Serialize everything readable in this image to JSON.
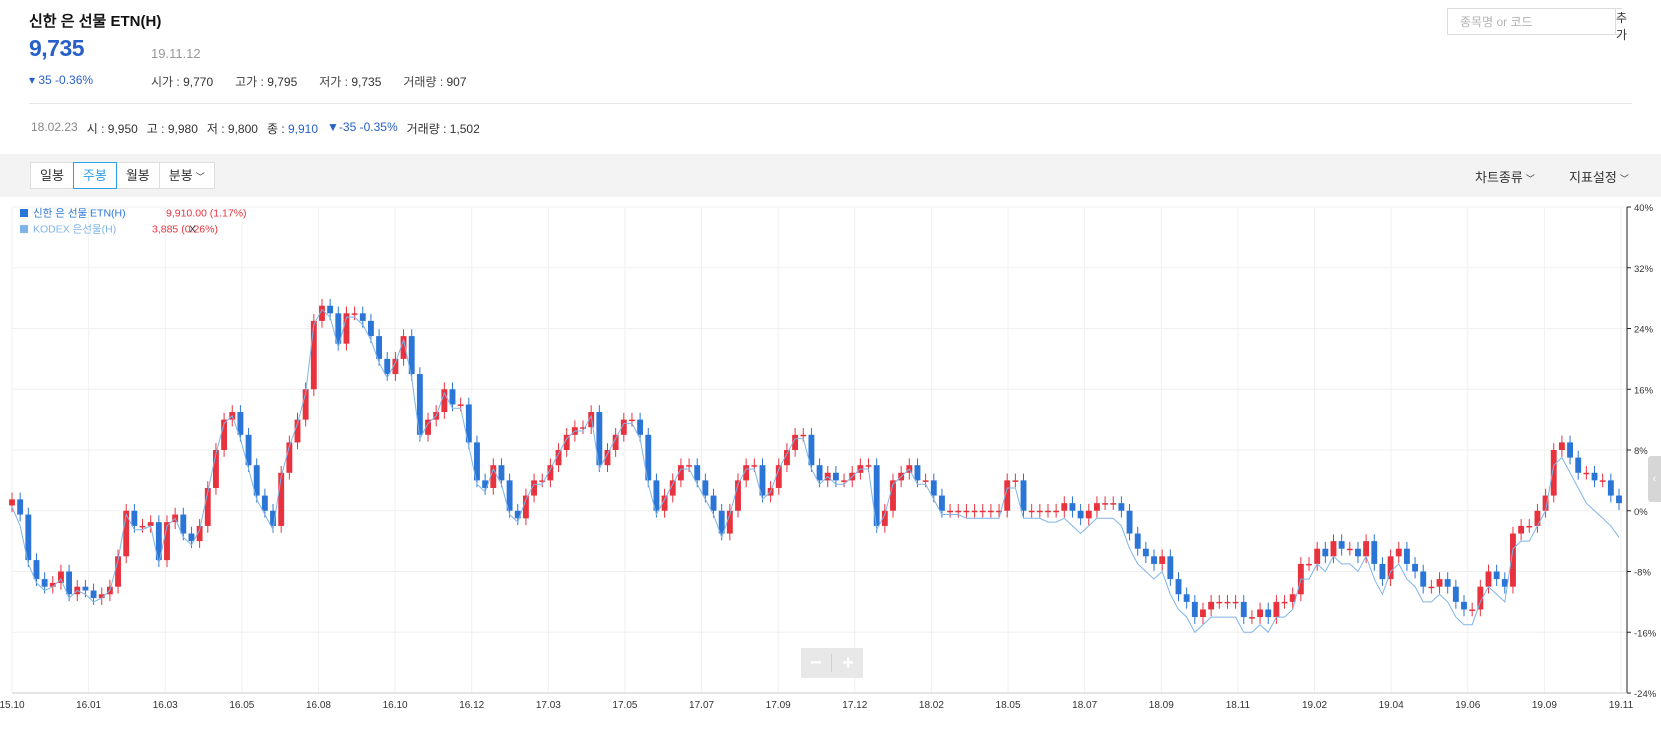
{
  "stock": {
    "title": "신한 은 선물 ETN(H)",
    "price": "9,735",
    "date": "19.11.12",
    "change": "▾ 35 -0.36%",
    "open_label": "시가 : ",
    "open": "9,770",
    "high_label": "고가 : ",
    "high": "9,795",
    "low_label": "저가 : ",
    "low": "9,735",
    "volume_label": "거래량 : ",
    "volume": "907"
  },
  "search": {
    "placeholder": "종목명 or 코드",
    "add_label": "추가"
  },
  "hover": {
    "date": "18.02.23",
    "open_label": "시 : ",
    "open": "9,950",
    "high_label": "고 : ",
    "high": "9,980",
    "low_label": "저 : ",
    "low": "9,800",
    "close_label": "종 : ",
    "close": "9,910",
    "change": "▼-35 -0.35%",
    "volume_label": "거래량 : ",
    "volume": "1,502"
  },
  "toolbar": {
    "tabs": [
      "일봉",
      "주봉",
      "월봉",
      "분봉"
    ],
    "active_tab": 1,
    "chart_type_label": "차트종류",
    "indicator_label": "지표설정"
  },
  "colors": {
    "up": "#e8333f",
    "down": "#2a75d6",
    "compare_line": "#7fb4e8",
    "accent": "#2760c9"
  },
  "chart_data": {
    "type": "candlestick",
    "y_unit": "%",
    "ylim": [
      -24,
      40
    ],
    "y_ticks": [
      "40%",
      "32%",
      "24%",
      "16%",
      "8%",
      "0%",
      "-8%",
      "-16%",
      "-24%"
    ],
    "x_ticks": [
      "15.10",
      "16.01",
      "16.03",
      "16.05",
      "16.08",
      "16.10",
      "16.12",
      "17.03",
      "17.05",
      "17.07",
      "17.09",
      "17.12",
      "18.02",
      "18.05",
      "18.07",
      "18.09",
      "18.11",
      "19.02",
      "19.04",
      "19.06",
      "19.09",
      "19.11"
    ],
    "legend": [
      {
        "name": "신한 은 선물 ETN(H)",
        "value": "9,910.00 (1.17%)",
        "color": "#2a75d6"
      },
      {
        "name": "KODEX 은선물(H)",
        "value": "3,885 (0.26%)",
        "color": "#7fb4e8",
        "remove": "X"
      }
    ],
    "grid": true,
    "main_series": [
      1.5,
      -0.5,
      -6.5,
      -9,
      -10,
      -9.5,
      -8,
      -11,
      -10,
      -10.5,
      -11.5,
      -11,
      -10,
      -6,
      0,
      -2,
      -2,
      -1.5,
      -6.5,
      -1.5,
      -0.5,
      -3,
      -4,
      -2,
      3,
      8,
      12,
      13,
      10,
      6,
      2,
      0,
      -2,
      5,
      9,
      12,
      16,
      25,
      27,
      26,
      22,
      26,
      26,
      25,
      23,
      20,
      18,
      20,
      23,
      18,
      10,
      12,
      13,
      16,
      14,
      14,
      9,
      4,
      3,
      6,
      4,
      0,
      -1,
      2,
      4,
      4,
      6,
      8,
      10,
      11,
      11,
      13,
      6,
      8,
      10,
      12,
      12,
      10,
      4,
      0,
      2,
      4,
      6,
      6,
      4,
      2,
      0,
      -3,
      0,
      4,
      6,
      6,
      2,
      3,
      6,
      8,
      10,
      10,
      6,
      4,
      5,
      4,
      4,
      5,
      6,
      6,
      -2,
      0,
      4,
      5,
      6,
      4,
      4,
      2,
      0,
      0,
      0,
      0,
      0,
      0,
      0,
      0,
      4,
      4,
      0,
      0,
      0,
      0,
      0,
      1,
      0,
      -1,
      0,
      1,
      1,
      1,
      0,
      -3,
      -5,
      -6,
      -7,
      -6,
      -9,
      -11,
      -12,
      -14,
      -13,
      -12,
      -12,
      -12,
      -12,
      -14,
      -14,
      -13,
      -14,
      -12,
      -12,
      -11,
      -7,
      -7,
      -5,
      -6,
      -4,
      -5,
      -5,
      -6,
      -4,
      -7,
      -9,
      -6,
      -5,
      -7,
      -8,
      -10,
      -10,
      -9,
      -10,
      -12,
      -13,
      -13,
      -10,
      -8,
      -9,
      -10,
      -3,
      -2,
      -2,
      0,
      2,
      8,
      9,
      7,
      5,
      5,
      4,
      4,
      2,
      1
    ],
    "compare_series": [
      0.5,
      -2,
      -7,
      -9.5,
      -10.5,
      -10,
      -9,
      -11.5,
      -10.5,
      -11,
      -12,
      -11.5,
      -10.5,
      -6.5,
      -0.5,
      -2.5,
      -2.5,
      -2,
      -7,
      -2,
      -1,
      -3.5,
      -4.5,
      -2.5,
      2.5,
      7.5,
      11.5,
      12.5,
      9.5,
      5.5,
      1.5,
      -0.5,
      -2.5,
      4.5,
      8.5,
      11.5,
      15.5,
      24.5,
      26.5,
      25.5,
      21.5,
      25.5,
      25.5,
      24.5,
      22.5,
      19.5,
      17.5,
      19.5,
      22.5,
      17.5,
      9.5,
      11.5,
      12.5,
      15.5,
      13.5,
      13.5,
      8.5,
      3.5,
      2.5,
      5.5,
      3.5,
      -0.5,
      -1.5,
      1.5,
      3.5,
      3.5,
      5.5,
      7.5,
      9.5,
      10.5,
      10.5,
      12.5,
      5.5,
      7.5,
      9.5,
      11.5,
      11.5,
      9.5,
      3.5,
      -0.5,
      1.5,
      3.5,
      5.5,
      5.5,
      3.5,
      1.5,
      -0.5,
      -3.5,
      -0.5,
      3.5,
      5.5,
      5.5,
      1.5,
      2.5,
      5.5,
      7.5,
      9.5,
      9.5,
      5.5,
      3.5,
      4.5,
      3.5,
      3.5,
      4.5,
      5.5,
      5.5,
      -2.5,
      -0.5,
      3.5,
      4.5,
      5.5,
      3.5,
      3.5,
      1.5,
      -0.5,
      -0.5,
      -0.5,
      -1,
      -1,
      -1,
      -1,
      -1,
      3,
      3,
      -1,
      -1,
      -1,
      -1.5,
      -1.5,
      -1,
      -2,
      -3,
      -2,
      -1,
      -1,
      -1,
      -2,
      -5,
      -7,
      -8,
      -9,
      -8,
      -11,
      -13,
      -14,
      -16,
      -15,
      -14,
      -14,
      -14,
      -14,
      -16,
      -16,
      -15,
      -16,
      -14,
      -14,
      -13,
      -9,
      -9,
      -7,
      -8,
      -6,
      -7,
      -7,
      -8,
      -6,
      -9,
      -11,
      -8,
      -7,
      -9,
      -10,
      -12,
      -12,
      -11,
      -12,
      -14,
      -15,
      -15,
      -12,
      -10,
      -11,
      -12,
      -5,
      -4,
      -4,
      -2,
      0,
      6,
      7,
      5,
      3,
      1,
      0,
      -1,
      -2,
      -3.5
    ]
  }
}
